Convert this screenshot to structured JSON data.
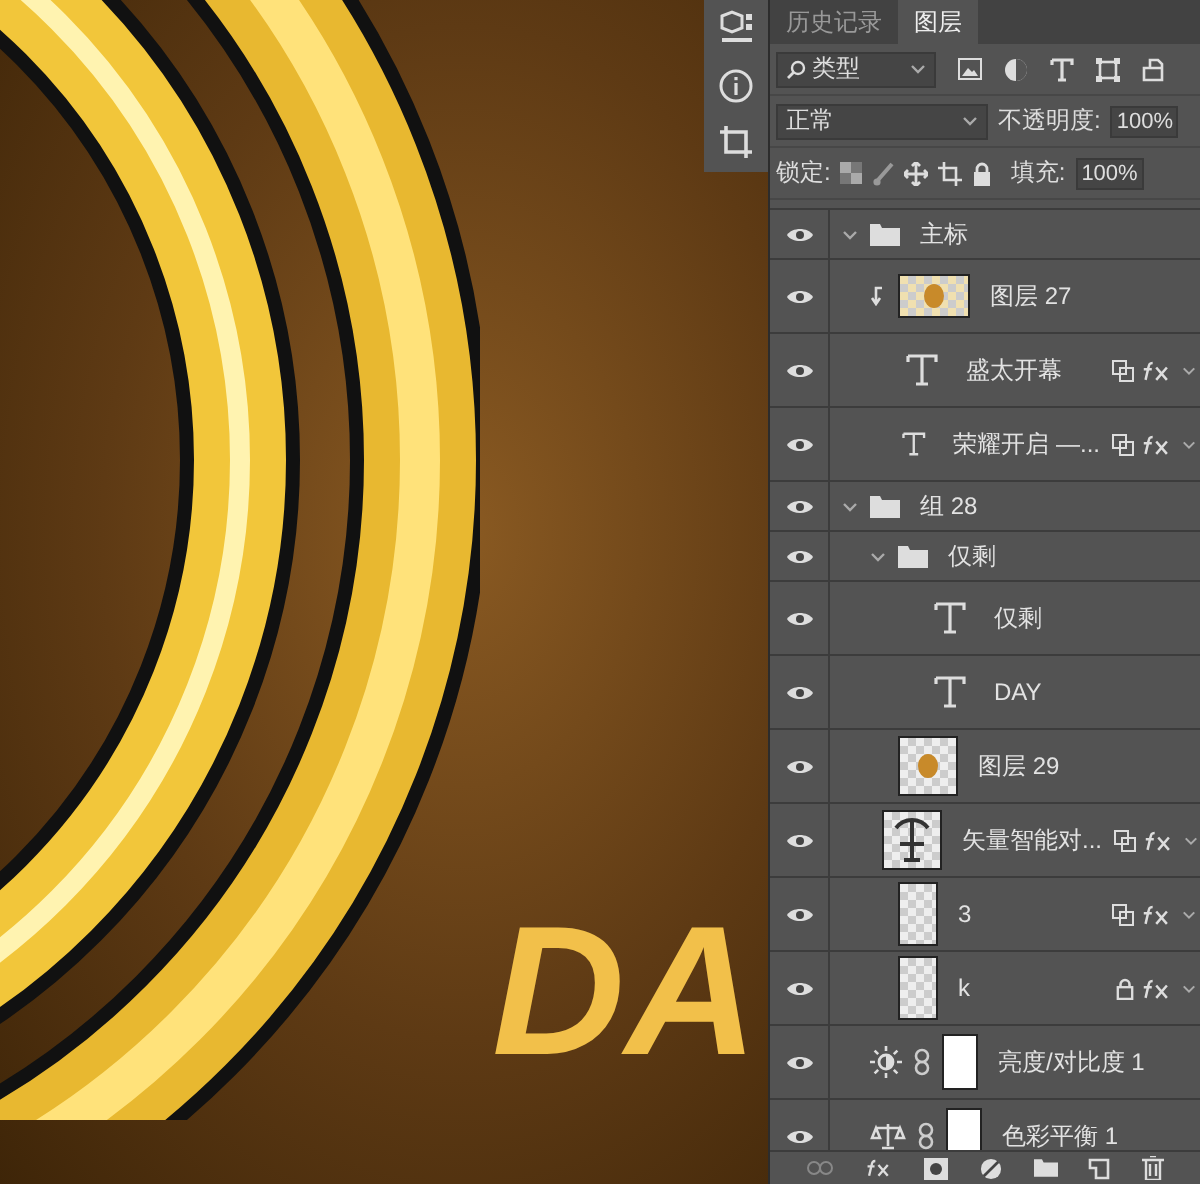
{
  "canvas": {
    "text": "DA"
  },
  "panel": {
    "tabs": [
      {
        "label": "历史记录",
        "selected": false
      },
      {
        "label": "图层",
        "selected": true
      }
    ],
    "filter": {
      "value": "类型"
    },
    "blend": {
      "value": "正常"
    },
    "opacity": {
      "label": "不透明度:",
      "value": "100%"
    },
    "lock": {
      "label": "锁定:"
    },
    "fill": {
      "label": "填充:",
      "value": "100%"
    }
  },
  "layers": [
    {
      "name": "主标",
      "kind": "group",
      "visible": true,
      "expanded": true,
      "children": [
        {
          "name": "图层 27",
          "kind": "image",
          "visible": true,
          "clipped": true,
          "fx": false,
          "locked": false
        },
        {
          "name": "盛太开幕",
          "kind": "text",
          "visible": true,
          "clipped": false,
          "fx": true,
          "locked": false
        },
        {
          "name": "荣耀开启 —...",
          "kind": "text",
          "visible": true,
          "clipped": false,
          "fx": true,
          "locked": false
        }
      ]
    },
    {
      "name": "组 28",
      "kind": "group",
      "visible": true,
      "expanded": true,
      "children": [
        {
          "name": "仅剩",
          "kind": "group",
          "visible": true,
          "expanded": true,
          "children": [
            {
              "name": "仅剩",
              "kind": "text",
              "visible": true,
              "clipped": false,
              "fx": false,
              "locked": false
            },
            {
              "name": "DAY",
              "kind": "text",
              "visible": true,
              "clipped": false,
              "fx": false,
              "locked": false
            }
          ]
        },
        {
          "name": "图层 29",
          "kind": "image",
          "visible": true,
          "clipped": false,
          "fx": false,
          "locked": false
        },
        {
          "name": "矢量智能对...",
          "kind": "smart",
          "visible": true,
          "clipped": false,
          "fx": true,
          "locked": false
        },
        {
          "name": "3",
          "kind": "tall",
          "visible": true,
          "clipped": false,
          "fx": true,
          "locked": false
        },
        {
          "name": "k",
          "kind": "tall",
          "visible": true,
          "clipped": false,
          "fx": true,
          "locked": true
        }
      ]
    },
    {
      "name": "亮度/对比度 1",
      "kind": "brightness",
      "visible": true,
      "clipped": false,
      "fx": false,
      "locked": false
    },
    {
      "name": "色彩平衡 1",
      "kind": "balance",
      "visible": true,
      "clipped": false,
      "fx": false,
      "locked": false
    }
  ]
}
